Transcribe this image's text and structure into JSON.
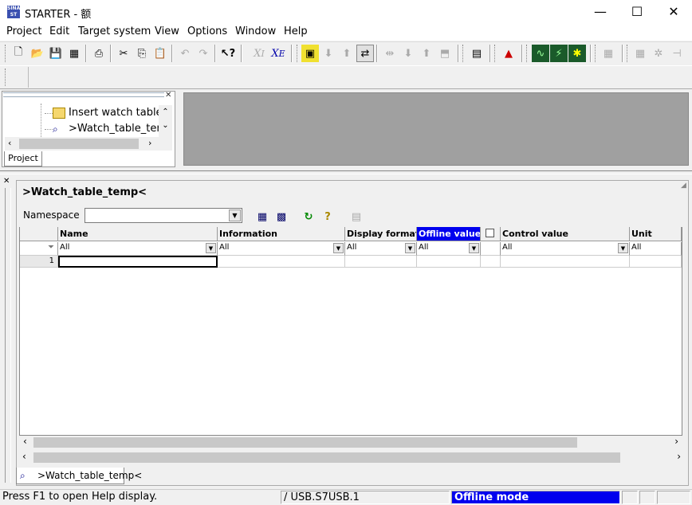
{
  "window": {
    "title": "STARTER - 额",
    "app_icon_text": "SINA ST",
    "minimize": "—",
    "maximize": "☐",
    "close": "✕"
  },
  "menu": [
    "Project",
    "Edit",
    "Target system",
    "View",
    "Options",
    "Window",
    "Help"
  ],
  "project_tree": {
    "items": [
      {
        "label": "Insert watch table",
        "icon": "insert-table-icon"
      },
      {
        "label": ">Watch_table_temp",
        "icon": "watch-table-icon"
      }
    ],
    "tab_label": "Project"
  },
  "watch_table": {
    "title": ">Watch_table_temp<",
    "namespace_label": "Namespace",
    "namespace_value": "",
    "columns": [
      "Name",
      "Information",
      "Display format",
      "Offline value",
      "",
      "Control value",
      "Unit"
    ],
    "selected_column": "Offline value",
    "filters": [
      "All",
      "All",
      "All",
      "All",
      "",
      "All",
      "All"
    ],
    "rows": [
      {
        "index": "1",
        "name": "",
        "information": "",
        "display_format": "",
        "offline_value": "",
        "control_value": "",
        "unit": ""
      }
    ],
    "tab_label": ">Watch_table_temp<"
  },
  "status_bar": {
    "help_text": "Press F1 to open Help display.",
    "interface": "/ USB.S7USB.1",
    "mode": "Offline mode",
    "mode_color": "#0000ee"
  },
  "colors": {
    "selected_header": "#0000ee",
    "grey_workspace": "#a0a0a0"
  }
}
